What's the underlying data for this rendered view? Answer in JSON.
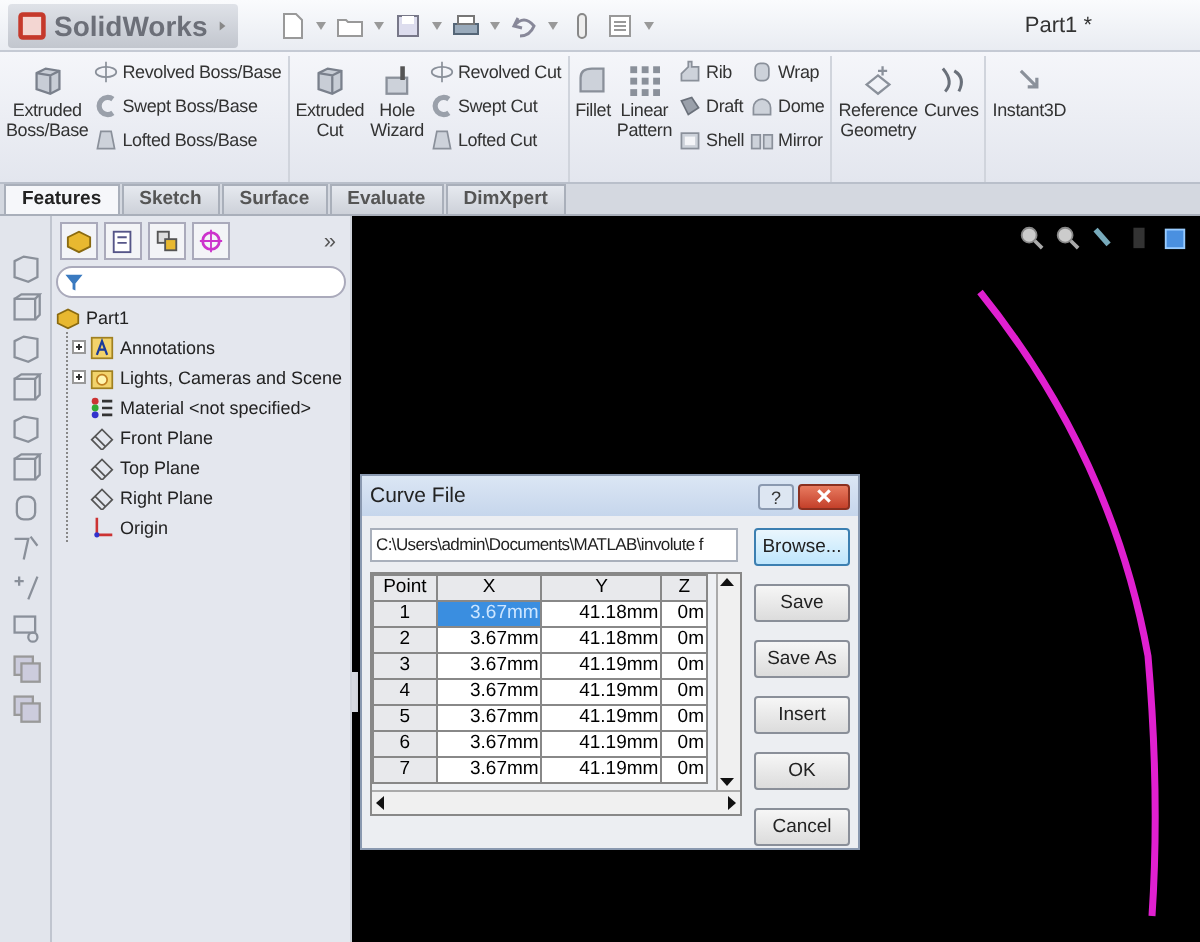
{
  "app": {
    "logo": "SolidWorks",
    "document_title": "Part1 *"
  },
  "ribbon": {
    "groups": [
      {
        "items": [
          {
            "kind": "large",
            "label": "Extruded\nBoss/Base"
          },
          {
            "kind": "stack",
            "items": [
              {
                "label": "Revolved Boss/Base"
              },
              {
                "label": "Swept Boss/Base"
              },
              {
                "label": "Lofted Boss/Base"
              }
            ]
          }
        ]
      },
      {
        "items": [
          {
            "kind": "large",
            "label": "Extruded\nCut"
          },
          {
            "kind": "large",
            "label": "Hole\nWizard"
          },
          {
            "kind": "stack",
            "items": [
              {
                "label": "Revolved Cut"
              },
              {
                "label": "Swept Cut"
              },
              {
                "label": "Lofted Cut"
              }
            ]
          }
        ]
      },
      {
        "items": [
          {
            "kind": "large",
            "label": "Fillet"
          },
          {
            "kind": "large",
            "label": "Linear\nPattern"
          },
          {
            "kind": "stack",
            "items": [
              {
                "label": "Rib"
              },
              {
                "label": "Draft"
              },
              {
                "label": "Shell"
              }
            ]
          },
          {
            "kind": "stack",
            "items": [
              {
                "label": "Wrap"
              },
              {
                "label": "Dome"
              },
              {
                "label": "Mirror"
              }
            ]
          }
        ]
      },
      {
        "items": [
          {
            "kind": "large",
            "label": "Reference\nGeometry"
          },
          {
            "kind": "large",
            "label": "Curves"
          }
        ]
      },
      {
        "items": [
          {
            "kind": "large",
            "label": "Instant3D"
          }
        ]
      }
    ]
  },
  "tabs": [
    {
      "label": "Features",
      "selected": true
    },
    {
      "label": "Sketch",
      "selected": false
    },
    {
      "label": "Surface",
      "selected": false
    },
    {
      "label": "Evaluate",
      "selected": false
    },
    {
      "label": "DimXpert",
      "selected": false
    }
  ],
  "feature_tree": {
    "overflow_glyph": "»",
    "root": {
      "label": "Part1",
      "kind": "part",
      "children": [
        {
          "label": "Annotations",
          "kind": "annotations",
          "expanded": false
        },
        {
          "label": "Lights, Cameras and Scene",
          "kind": "lights",
          "expanded": false
        },
        {
          "label": "Material <not specified>",
          "kind": "material"
        },
        {
          "label": "Front Plane",
          "kind": "plane"
        },
        {
          "label": "Top Plane",
          "kind": "plane"
        },
        {
          "label": "Right Plane",
          "kind": "plane"
        },
        {
          "label": "Origin",
          "kind": "origin"
        }
      ]
    }
  },
  "dialog": {
    "title": "Curve File",
    "help_glyph": "?",
    "path": "C:\\Users\\admin\\Documents\\MATLAB\\involute f",
    "table": {
      "columns": [
        "Point",
        "X",
        "Y",
        "Z"
      ],
      "rows": [
        {
          "point": "1",
          "x": "3.67mm",
          "y": "41.18mm",
          "z": "0m",
          "selected": true
        },
        {
          "point": "2",
          "x": "3.67mm",
          "y": "41.18mm",
          "z": "0m",
          "selected": false
        },
        {
          "point": "3",
          "x": "3.67mm",
          "y": "41.19mm",
          "z": "0m",
          "selected": false
        },
        {
          "point": "4",
          "x": "3.67mm",
          "y": "41.19mm",
          "z": "0m",
          "selected": false
        },
        {
          "point": "5",
          "x": "3.67mm",
          "y": "41.19mm",
          "z": "0m",
          "selected": false
        },
        {
          "point": "6",
          "x": "3.67mm",
          "y": "41.19mm",
          "z": "0m",
          "selected": false
        },
        {
          "point": "7",
          "x": "3.67mm",
          "y": "41.19mm",
          "z": "0m",
          "selected": false
        }
      ]
    },
    "buttons": [
      {
        "label": "Browse...",
        "kind": "default"
      },
      {
        "label": "Save",
        "kind": "normal"
      },
      {
        "label": "Save As",
        "kind": "normal"
      },
      {
        "label": "Insert",
        "kind": "normal"
      },
      {
        "label": "OK",
        "kind": "normal"
      },
      {
        "label": "Cancel",
        "kind": "normal"
      }
    ]
  }
}
